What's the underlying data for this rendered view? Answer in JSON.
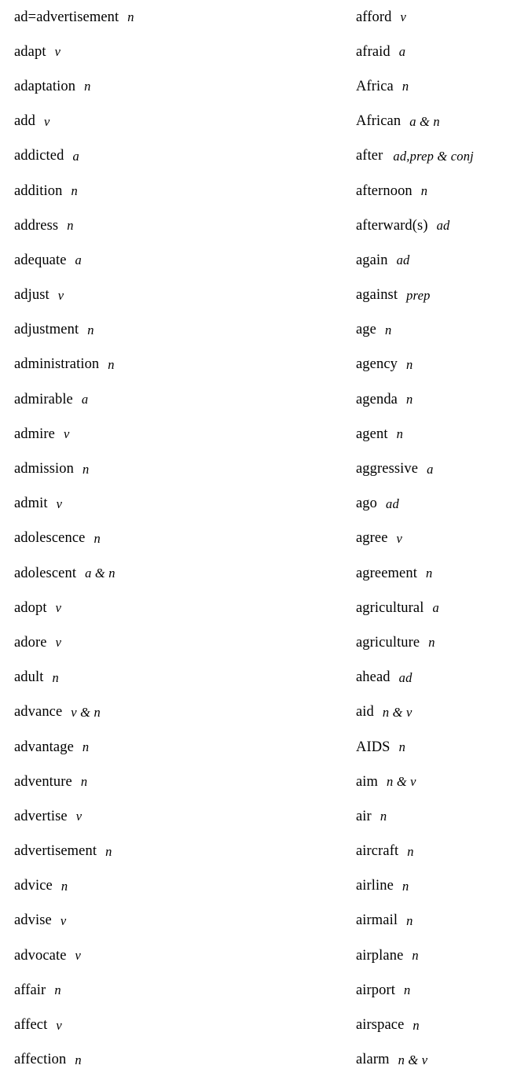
{
  "document": {
    "type": "vocabulary-word-list",
    "layout": "two-column",
    "rows_per_column": 31,
    "text_color": "#000000",
    "background_color": "#ffffff"
  },
  "columns": [
    {
      "name": "left-column",
      "entries": [
        {
          "word": "ad=advertisement",
          "pos": "n"
        },
        {
          "word": "adapt",
          "pos": "v"
        },
        {
          "word": "adaptation",
          "pos": "n"
        },
        {
          "word": "add",
          "pos": "v"
        },
        {
          "word": "addicted",
          "pos": "a"
        },
        {
          "word": "addition",
          "pos": "n"
        },
        {
          "word": "address",
          "pos": "n"
        },
        {
          "word": "adequate",
          "pos": "a"
        },
        {
          "word": "adjust",
          "pos": "v"
        },
        {
          "word": "adjustment",
          "pos": "n"
        },
        {
          "word": "administration",
          "pos": "n"
        },
        {
          "word": "admirable",
          "pos": "a"
        },
        {
          "word": "admire",
          "pos": "v"
        },
        {
          "word": "admission",
          "pos": "n"
        },
        {
          "word": "admit",
          "pos": "v"
        },
        {
          "word": "adolescence",
          "pos": "n"
        },
        {
          "word": "adolescent",
          "pos": "a & n"
        },
        {
          "word": "adopt",
          "pos": "v"
        },
        {
          "word": "adore",
          "pos": "v"
        },
        {
          "word": "adult",
          "pos": "n"
        },
        {
          "word": "advance",
          "pos": "v & n"
        },
        {
          "word": "advantage",
          "pos": "n"
        },
        {
          "word": "adventure",
          "pos": "n"
        },
        {
          "word": "advertise",
          "pos": "v"
        },
        {
          "word": "advertisement",
          "pos": "n"
        },
        {
          "word": "advice",
          "pos": "n"
        },
        {
          "word": "advise",
          "pos": "v"
        },
        {
          "word": "advocate",
          "pos": "v"
        },
        {
          "word": "affair",
          "pos": "n"
        },
        {
          "word": "affect",
          "pos": "v"
        },
        {
          "word": "affection",
          "pos": "n"
        }
      ]
    },
    {
      "name": "right-column",
      "entries": [
        {
          "word": "afford",
          "pos": "v"
        },
        {
          "word": "afraid",
          "pos": "a"
        },
        {
          "word": "Africa",
          "pos": "n"
        },
        {
          "word": "African",
          "pos": "a & n"
        },
        {
          "word": "after",
          "pos": "ad,prep & conj"
        },
        {
          "word": "afternoon",
          "pos": "n"
        },
        {
          "word": "afterward(s)",
          "pos": "ad"
        },
        {
          "word": "again",
          "pos": "ad"
        },
        {
          "word": "against",
          "pos": "prep"
        },
        {
          "word": "age",
          "pos": "n"
        },
        {
          "word": "agency",
          "pos": "n"
        },
        {
          "word": "agenda",
          "pos": "n"
        },
        {
          "word": "agent",
          "pos": "n"
        },
        {
          "word": "aggressive",
          "pos": "a"
        },
        {
          "word": "ago",
          "pos": "ad"
        },
        {
          "word": "agree",
          "pos": "v"
        },
        {
          "word": "agreement",
          "pos": "n"
        },
        {
          "word": "agricultural",
          "pos": "a"
        },
        {
          "word": "agriculture",
          "pos": "n"
        },
        {
          "word": "ahead",
          "pos": "ad"
        },
        {
          "word": "aid",
          "pos": "n & v"
        },
        {
          "word": "AIDS",
          "pos": "n"
        },
        {
          "word": "aim",
          "pos": "n & v"
        },
        {
          "word": "air",
          "pos": "n"
        },
        {
          "word": "aircraft",
          "pos": "n"
        },
        {
          "word": "airline",
          "pos": "n"
        },
        {
          "word": "airmail",
          "pos": "n"
        },
        {
          "word": "airplane",
          "pos": "n"
        },
        {
          "word": "airport",
          "pos": "n"
        },
        {
          "word": "airspace",
          "pos": "n"
        },
        {
          "word": "alarm",
          "pos": "n & v"
        }
      ]
    }
  ]
}
